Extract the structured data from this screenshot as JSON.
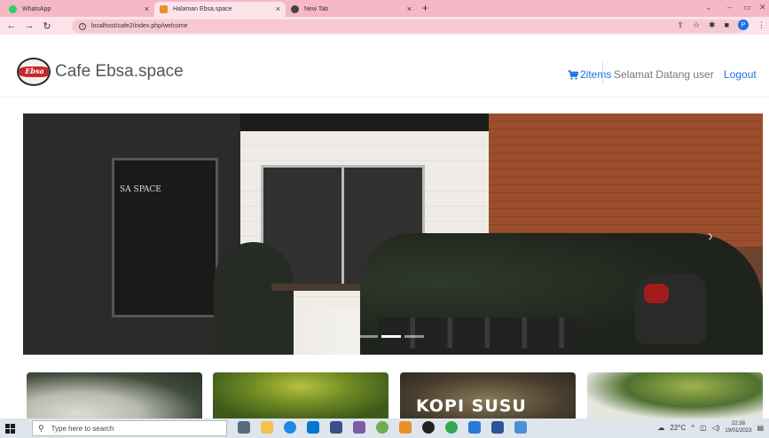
{
  "browser": {
    "tabs": [
      {
        "label": "WhatsApp",
        "favicon_color": "#25d366",
        "active": false
      },
      {
        "label": "Halaman Ebsa.space",
        "favicon_color": "#e8912a",
        "active": true
      },
      {
        "label": "New Tab",
        "favicon_color": "#444444",
        "active": false
      }
    ],
    "close_glyph": "×",
    "new_tab_glyph": "+",
    "url": "localhost/cafe2/index.php/welcome",
    "profile_initial": "P"
  },
  "site": {
    "logo_text": "Ebsa",
    "brand": "Cafe Ebsa.space",
    "cart_label": "2items",
    "welcome": "Selamat Datang user",
    "logout": "Logout",
    "accent_color": "#1a73e8"
  },
  "hero": {
    "sign_text": "SA SPACE",
    "slides_count": 3,
    "active_slide": 2
  },
  "products": [
    {
      "image": "drink-glass"
    },
    {
      "image": "green-leaves"
    },
    {
      "image": "kopi-susu",
      "text": "KOPI SUSU"
    },
    {
      "image": "plant-leaf"
    }
  ],
  "taskbar": {
    "search_placeholder": "Type here to search",
    "weather": "22°C",
    "time": "22:38",
    "date": "19/01/2023"
  }
}
